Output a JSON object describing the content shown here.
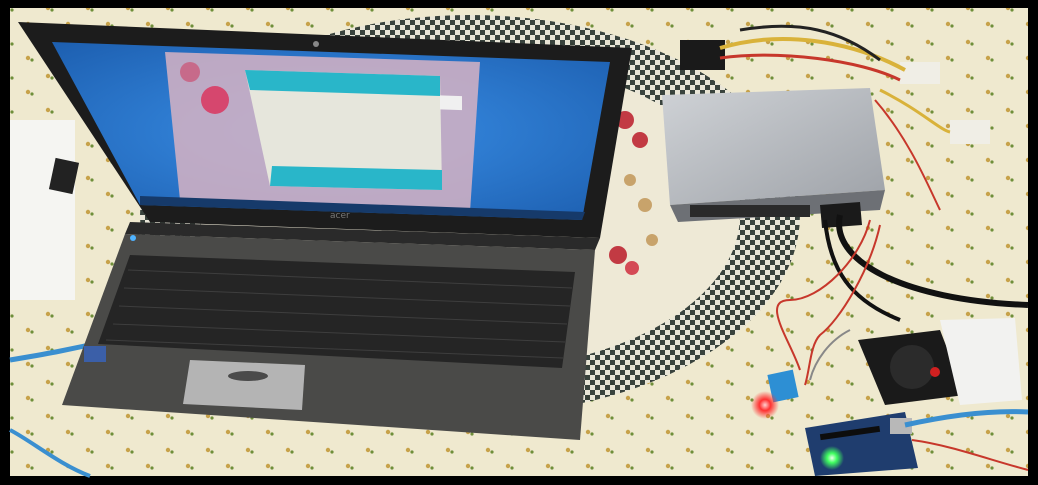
{
  "photo": {
    "subject": "laptop-arduino-psu-setup",
    "laptop_brand": "acer",
    "colors": {
      "frame": "#000000",
      "tablecloth": "#efe9cf",
      "laptop_body": "#4a4a48",
      "screen_glow": "#2d7bd6",
      "app_window": "#29b6c9",
      "psu_metal": "#b9bcc0",
      "arduino_board": "#1f3d6e",
      "sensor_blue": "#2d8fd4",
      "led_red": "#ff3030",
      "led_green": "#40ff60"
    }
  }
}
